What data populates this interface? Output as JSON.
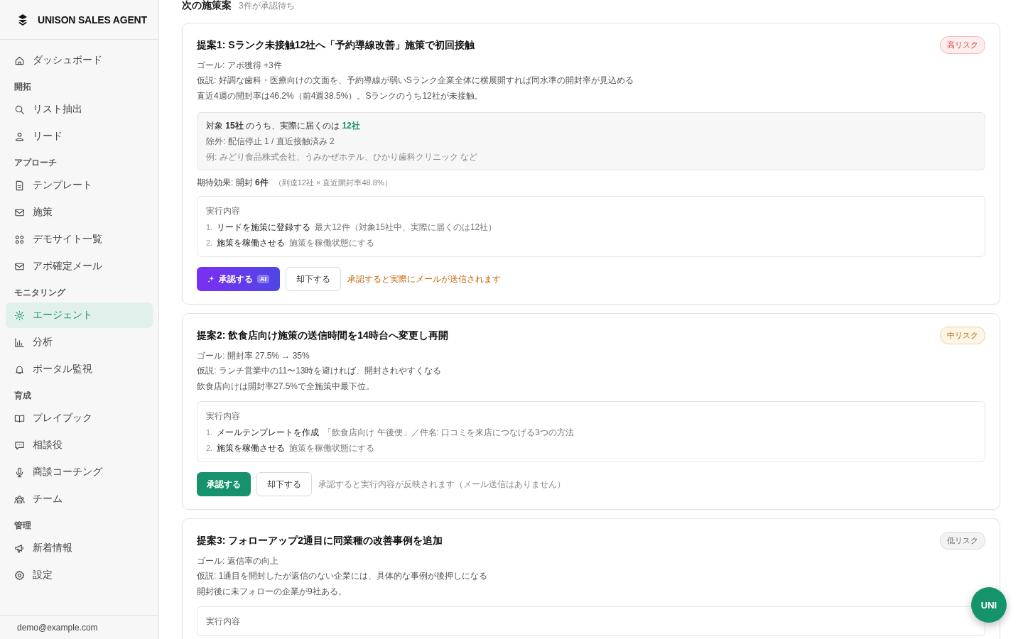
{
  "sidebar": {
    "brand": "UNISON SALES AGENT",
    "sections": [
      {
        "items": [
          {
            "label": "ダッシュボード",
            "selected": false
          }
        ]
      },
      {
        "heading": "開拓",
        "items": [
          {
            "label": "リスト抽出",
            "selected": false
          },
          {
            "label": "リード",
            "selected": false
          }
        ]
      },
      {
        "heading": "アプローチ",
        "items": [
          {
            "label": "テンプレート",
            "selected": false
          },
          {
            "label": "施策",
            "selected": false
          },
          {
            "label": "デモサイト一覧",
            "selected": false
          },
          {
            "label": "アポ確定メール",
            "selected": false
          }
        ]
      },
      {
        "heading": "モニタリング",
        "items": [
          {
            "label": "エージェント",
            "selected": true
          },
          {
            "label": "分析",
            "selected": false
          },
          {
            "label": "ポータル監視",
            "selected": false
          }
        ]
      },
      {
        "heading": "育成",
        "items": [
          {
            "label": "プレイブック",
            "selected": false
          },
          {
            "label": "相談役",
            "selected": false
          },
          {
            "label": "商談コーチング",
            "selected": false
          },
          {
            "label": "チーム",
            "selected": false
          }
        ]
      },
      {
        "heading": "管理",
        "items": [
          {
            "label": "新着情報",
            "selected": false
          },
          {
            "label": "設定",
            "selected": false
          }
        ]
      }
    ],
    "user_email": "demo@example.com"
  },
  "header": {
    "title": "次の施策案",
    "subtitle": "3件が承認待ち"
  },
  "proposals": [
    {
      "title": "提案1: Sランク未接触12社へ「予約導線改善」施策で初回接触",
      "risk": {
        "label": "高リスク",
        "kind": "high"
      },
      "goal": "ゴール: アポ獲得 +3件",
      "hypothesis": "仮説: 好調な歯科・医療向けの文面を、予約導線が弱いSランク企業全体に横展開すれば同水準の開封率が見込める",
      "evidence": "直近4週の開封率は46.2%（前4週38.5%）。Sランクのうち12社が未接触。",
      "target": {
        "summary": "対象 **15社** のうち、実際に届くのは **12社**",
        "exclusions": "除外: 配信停止 1 / 直近接触済み 2",
        "examples": "例: みどり食品株式会社、うみかぜホテル、ひかり歯科クリニック など"
      },
      "effect": {
        "text": "期待効果: 開封 **6件**",
        "note": "（到達12社 × 直近開封率48.8%）"
      },
      "steps_heading": "実行内容",
      "steps": [
        {
          "number": "1.",
          "action": "リードを施策に登録する",
          "detail": "最大12件（対象15社中、実際に届くのは12社）"
        },
        {
          "number": "2.",
          "action": "施策を稼働させる",
          "detail": "施策を稼働状態にする"
        }
      ],
      "approve": {
        "label": "承認する",
        "kind": "ai",
        "badge": "AI"
      },
      "reject": "却下する",
      "note": {
        "text": "承認すると実際にメールが送信されます",
        "warning": true
      }
    },
    {
      "title": "提案2: 飲食店向け施策の送信時間を14時台へ変更し再開",
      "risk": {
        "label": "中リスク",
        "kind": "medium"
      },
      "goal": "ゴール: 開封率 27.5% → 35%",
      "hypothesis": "仮説: ランチ営業中の11〜13時を避ければ、開封されやすくなる",
      "evidence": "飲食店向けは開封率27.5%で全施策中最下位。",
      "steps_heading": "実行内容",
      "steps": [
        {
          "number": "1.",
          "action": "メールテンプレートを作成",
          "detail": "「飲食店向け 午後便」／件名: 口コミを来店につなげる3つの方法"
        },
        {
          "number": "2.",
          "action": "施策を稼働させる",
          "detail": "施策を稼働状態にする"
        }
      ],
      "approve": {
        "label": "承認する",
        "kind": "plain"
      },
      "reject": "却下する",
      "note": {
        "text": "承認すると実行内容が反映されます（メール送信はありません）",
        "warning": false
      }
    },
    {
      "title": "提案3: フォローアップ2通目に同業種の改善事例を追加",
      "risk": {
        "label": "低リスク",
        "kind": "low"
      },
      "goal": "ゴール: 返信率の向上",
      "hypothesis": "仮説: 1通目を開封したが返信のない企業には、具体的な事例が後押しになる",
      "evidence": "開封後に未フォローの企業が9社ある。",
      "steps_heading": "実行内容"
    }
  ],
  "assistant_button": "UNI"
}
